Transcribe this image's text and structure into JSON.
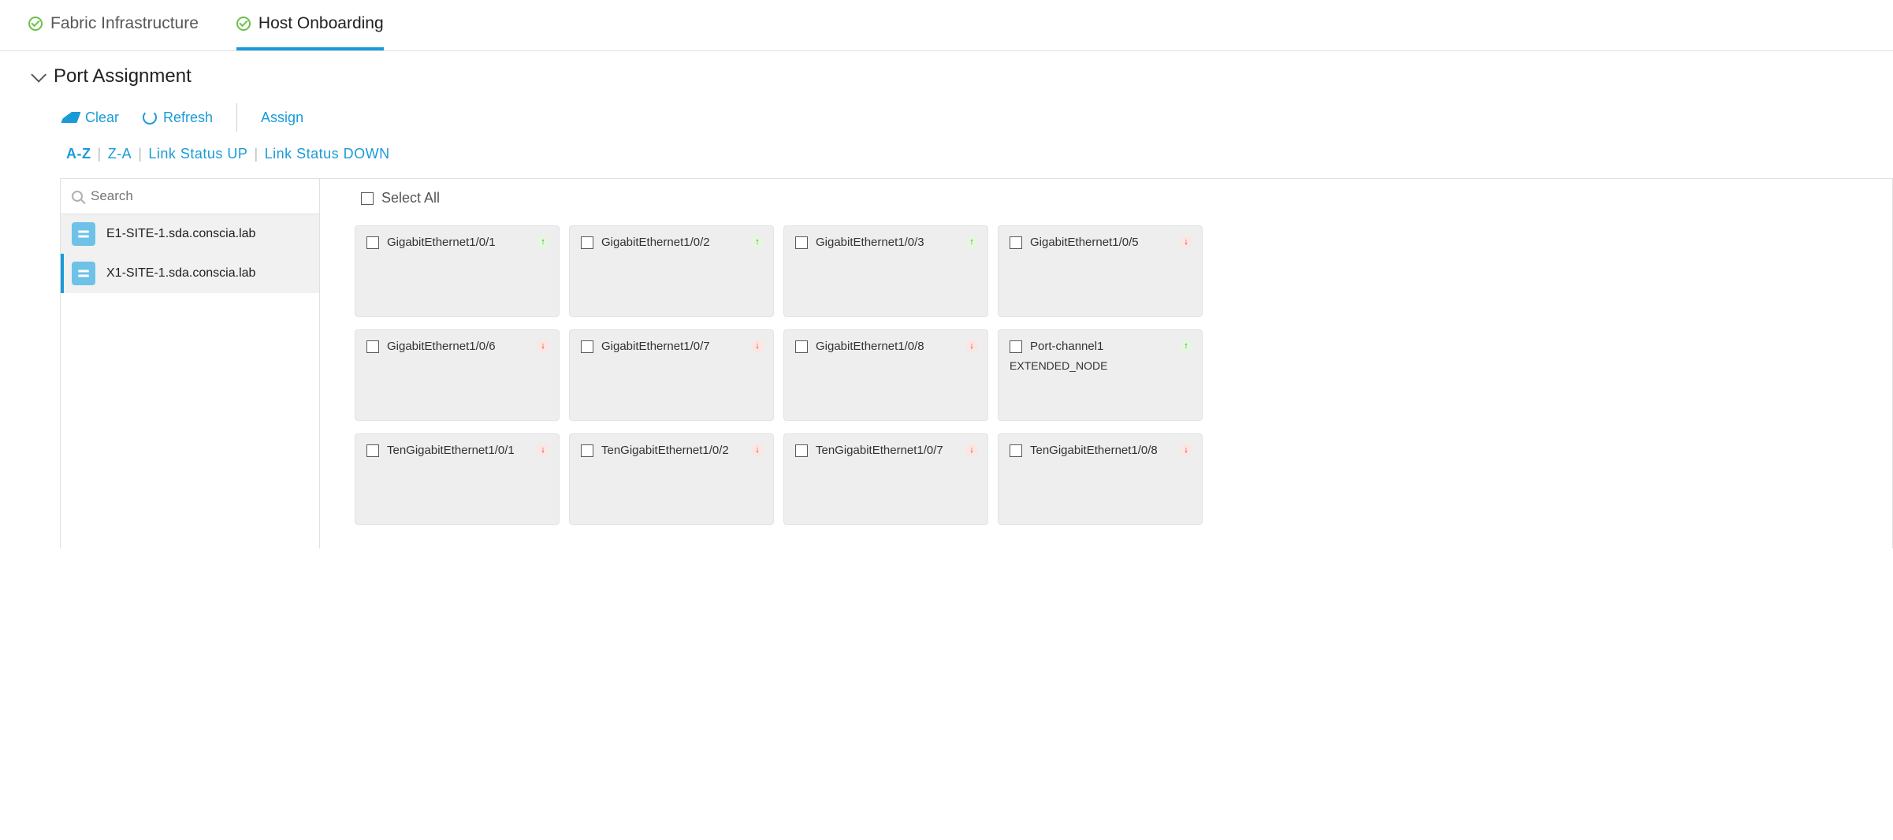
{
  "tabs": {
    "fabric": "Fabric Infrastructure",
    "host": "Host Onboarding"
  },
  "section": {
    "title": "Port Assignment"
  },
  "toolbar": {
    "clear": "Clear",
    "refresh": "Refresh",
    "assign": "Assign"
  },
  "sort": {
    "az": "A-Z",
    "za": "Z-A",
    "up": "Link Status UP",
    "down": "Link Status DOWN"
  },
  "search": {
    "placeholder": "Search"
  },
  "devices": {
    "items": [
      {
        "name": "E1-SITE-1.sda.conscia.lab"
      },
      {
        "name": "X1-SITE-1.sda.conscia.lab"
      }
    ]
  },
  "select_all": "Select All",
  "ports": [
    {
      "name": "GigabitEthernet1/0/1",
      "status": "up",
      "sub": ""
    },
    {
      "name": "GigabitEthernet1/0/2",
      "status": "up",
      "sub": ""
    },
    {
      "name": "GigabitEthernet1/0/3",
      "status": "up",
      "sub": ""
    },
    {
      "name": "GigabitEthernet1/0/5",
      "status": "down",
      "sub": ""
    },
    {
      "name": "GigabitEthernet1/0/6",
      "status": "down",
      "sub": ""
    },
    {
      "name": "GigabitEthernet1/0/7",
      "status": "down",
      "sub": ""
    },
    {
      "name": "GigabitEthernet1/0/8",
      "status": "down",
      "sub": ""
    },
    {
      "name": "Port-channel1",
      "status": "up",
      "sub": "EXTENDED_NODE"
    },
    {
      "name": "TenGigabitEthernet1/0/1",
      "status": "down",
      "sub": ""
    },
    {
      "name": "TenGigabitEthernet1/0/2",
      "status": "down",
      "sub": ""
    },
    {
      "name": "TenGigabitEthernet1/0/7",
      "status": "down",
      "sub": ""
    },
    {
      "name": "TenGigabitEthernet1/0/8",
      "status": "down",
      "sub": ""
    }
  ],
  "arrows": {
    "up": "↑",
    "down": "↓"
  }
}
